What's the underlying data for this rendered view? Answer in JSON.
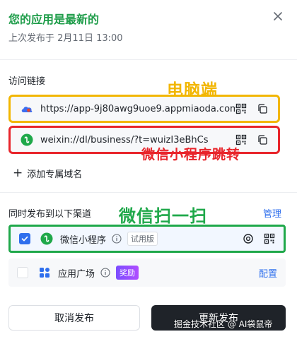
{
  "header": {
    "title": "您的应用是最新的",
    "subtitle": "上次发布于 2月11日 13:00"
  },
  "links": {
    "section_label": "访问链接",
    "web_url": "https://app-9j80awg9uoe9.appmiaoda.com",
    "wx_url": "weixin://dl/business/?t=wuizI3eBhCs",
    "add_domain_label": "添加专属域名"
  },
  "annotations": {
    "pc": "电脑端",
    "mini_program_jump": "微信小程序跳转",
    "wechat_scan": "微信扫一扫"
  },
  "channels": {
    "title": "同时发布到以下渠道",
    "manage_label": "管理",
    "items": [
      {
        "name": "微信小程序",
        "tag": "试用版",
        "checked": true
      },
      {
        "name": "应用广场",
        "tag": "奖励",
        "action": "配置",
        "checked": false
      }
    ]
  },
  "footer": {
    "cancel_label": "取消发布",
    "publish_label": "更新发布"
  },
  "watermark": "掘金技术社区 @ AI袋鼠帝",
  "colors": {
    "title_green": "#1f9d4a",
    "accent_blue": "#2f6fed",
    "annotation_yellow": "#f2b600",
    "annotation_red": "#e8252b",
    "annotation_green": "#1fa84a"
  }
}
